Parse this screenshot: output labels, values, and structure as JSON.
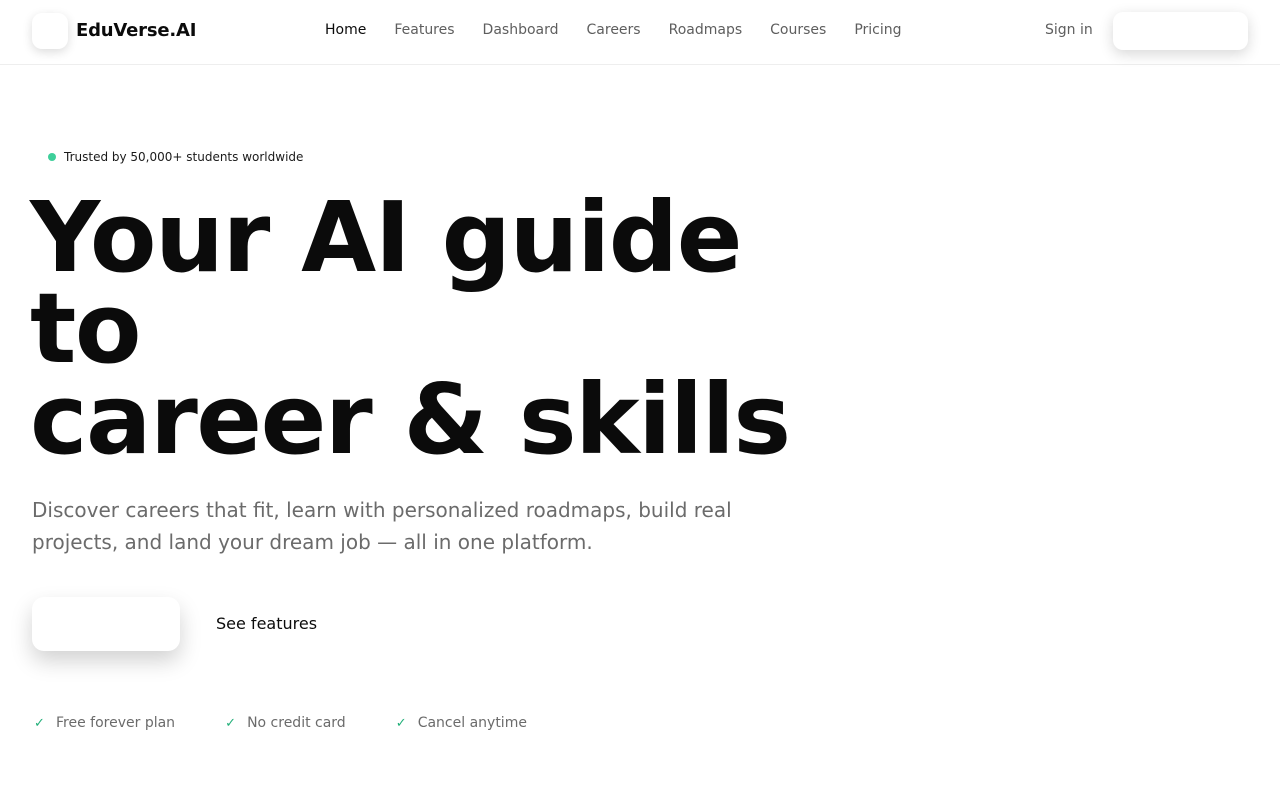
{
  "header": {
    "brand": "EduVerse.AI",
    "nav": [
      {
        "label": "Home",
        "active": true
      },
      {
        "label": "Features",
        "active": false
      },
      {
        "label": "Dashboard",
        "active": false
      },
      {
        "label": "Careers",
        "active": false
      },
      {
        "label": "Roadmaps",
        "active": false
      },
      {
        "label": "Courses",
        "active": false
      },
      {
        "label": "Pricing",
        "active": false
      }
    ],
    "signin_label": "Sign in"
  },
  "hero": {
    "trust_badge": "Trusted by 50,000+ students worldwide",
    "headline_lines": [
      "Your AI guide",
      "to",
      "career & skills"
    ],
    "subtitle": "Discover careers that fit, learn with personalized roadmaps, build real projects, and land your dream job — all in one platform.",
    "secondary_cta": "See features",
    "checks": [
      "Free forever plan",
      "No credit card",
      "Cancel anytime"
    ]
  },
  "colors": {
    "accent_green": "#3ecf9a",
    "check_green": "#23b07a",
    "text_dark": "#0b0b0b",
    "text_muted": "#6b6b6b"
  },
  "icons": {
    "check": "check-icon",
    "status_dot": "status-dot-icon"
  }
}
